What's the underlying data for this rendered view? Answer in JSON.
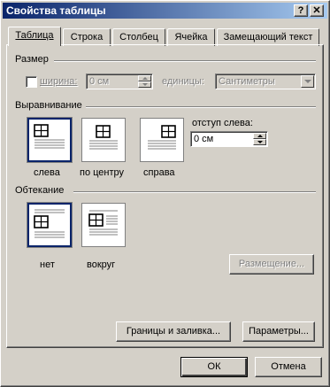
{
  "window": {
    "title": "Свойства таблицы"
  },
  "titlebar": {
    "help_label": "?",
    "close_label": "✕"
  },
  "tabs": [
    {
      "label": "Таблица",
      "active": true
    },
    {
      "label": "Строка"
    },
    {
      "label": "Столбец"
    },
    {
      "label": "Ячейка"
    },
    {
      "label": "Замещающий текст"
    }
  ],
  "size": {
    "heading": "Размер",
    "width_label": "ширина:",
    "width_value": "0 см",
    "units_label": "единицы:",
    "units_value": "Сантиметры"
  },
  "alignment": {
    "heading": "Выравнивание",
    "options": [
      {
        "label": "слева",
        "selected": true
      },
      {
        "label": "по центру"
      },
      {
        "label": "справа"
      }
    ],
    "indent_label": "отступ слева:",
    "indent_value": "0 см"
  },
  "wrapping": {
    "heading": "Обтекание",
    "options": [
      {
        "label": "нет",
        "selected": true
      },
      {
        "label": "вокруг"
      }
    ],
    "positioning_label": "Размещение..."
  },
  "buttons": {
    "borders_label": "Границы и заливка...",
    "options_label": "Параметры...",
    "ok_label": "ОК",
    "cancel_label": "Отмена"
  }
}
